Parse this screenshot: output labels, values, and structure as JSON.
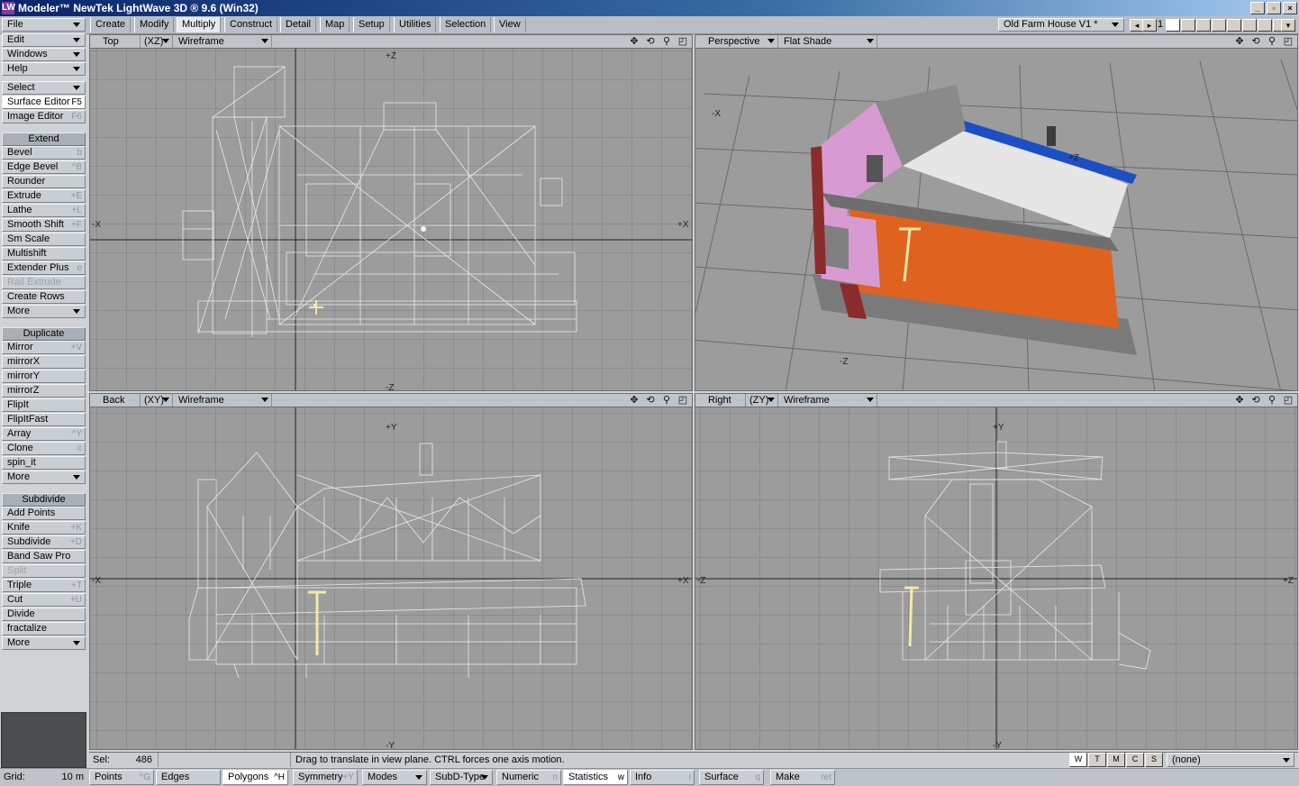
{
  "window": {
    "title": "Modeler™ NewTek LightWave 3D ® 9.6  (Win32)",
    "logo": "LW",
    "min": "_",
    "max": "▫",
    "close": "×"
  },
  "menu_tabs": [
    "Create",
    "Modify",
    "Multiply",
    "Construct",
    "Detail",
    "Map",
    "Setup",
    "Utilities",
    "Selection",
    "View"
  ],
  "active_tab": "Multiply",
  "object": {
    "name": "Old Farm House V1 *",
    "layer": "1"
  },
  "left_menus": [
    "File",
    "Edit",
    "Windows",
    "Help"
  ],
  "select_label": "Select",
  "surface_editor": {
    "label": "Surface Editor",
    "shortcut": "F5"
  },
  "image_editor": {
    "label": "Image Editor",
    "shortcut": "F6"
  },
  "extend": {
    "title": "Extend",
    "items": [
      {
        "label": "Bevel",
        "sc": "b"
      },
      {
        "label": "Edge Bevel",
        "sc": "^B"
      },
      {
        "label": "Rounder",
        "sc": ""
      },
      {
        "label": "Extrude",
        "sc": "+E"
      },
      {
        "label": "Lathe",
        "sc": "+L"
      },
      {
        "label": "Smooth Shift",
        "sc": "+F"
      },
      {
        "label": "Sm Scale",
        "sc": ""
      },
      {
        "label": "Multishift",
        "sc": ""
      },
      {
        "label": "Extender Plus",
        "sc": "e"
      },
      {
        "label": "Rail Extrude",
        "sc": ""
      },
      {
        "label": "Create Rows",
        "sc": ""
      },
      {
        "label": "More",
        "sc": ""
      }
    ]
  },
  "duplicate": {
    "title": "Duplicate",
    "items": [
      {
        "label": "Mirror",
        "sc": "+V"
      },
      {
        "label": "mirrorX",
        "sc": ""
      },
      {
        "label": "mirrorY",
        "sc": ""
      },
      {
        "label": "mirrorZ",
        "sc": ""
      },
      {
        "label": "FlipIt",
        "sc": ""
      },
      {
        "label": "FlipItFast",
        "sc": ""
      },
      {
        "label": "Array",
        "sc": "^Y"
      },
      {
        "label": "Clone",
        "sc": "c"
      },
      {
        "label": "spin_it",
        "sc": ""
      },
      {
        "label": "More",
        "sc": ""
      }
    ]
  },
  "subdivide": {
    "title": "Subdivide",
    "items": [
      {
        "label": "Add Points",
        "sc": ""
      },
      {
        "label": "Knife",
        "sc": "+K"
      },
      {
        "label": "Subdivide",
        "sc": "+D"
      },
      {
        "label": "Band Saw Pro",
        "sc": ""
      },
      {
        "label": "Split",
        "sc": ""
      },
      {
        "label": "Triple",
        "sc": "+T"
      },
      {
        "label": "Cut",
        "sc": "+U"
      },
      {
        "label": "Divide",
        "sc": ""
      },
      {
        "label": "fractalize",
        "sc": ""
      },
      {
        "label": "More",
        "sc": ""
      }
    ]
  },
  "viewports": {
    "top": {
      "view": "Top",
      "axes": "(XZ)",
      "mode": "Wireframe",
      "label_top": "+Z",
      "label_bottom": "-Z",
      "label_left": "-X",
      "label_right": "+X"
    },
    "persp": {
      "view": "Perspective",
      "mode": "Flat Shade",
      "label_x": "-X",
      "label_z": "+Z",
      "label_nz": "-Z"
    },
    "back": {
      "view": "Back",
      "axes": "(XY)",
      "mode": "Wireframe",
      "label_top": "+Y",
      "label_bottom": "-Y",
      "label_left": "-X",
      "label_right": "+X"
    },
    "right": {
      "view": "Right",
      "axes": "(ZY)",
      "mode": "Wireframe",
      "label_top": "+Y",
      "label_bottom": "-Y",
      "label_left": "-Z",
      "label_right": "+Z"
    }
  },
  "vp_icons": {
    "move": "✥",
    "rotate": "⟲",
    "zoom": "⚲",
    "max": "◰"
  },
  "status": {
    "sel_label": "Sel:",
    "sel_value": "486",
    "message": "Drag to translate in view plane. CTRL forces one axis motion.",
    "wtmcs": [
      "W",
      "T",
      "M",
      "C",
      "S"
    ],
    "surface": "(none)"
  },
  "grid": {
    "label": "Grid:",
    "value": "10 m"
  },
  "bottom": [
    {
      "label": "Points",
      "sc": "^G"
    },
    {
      "label": "Edges",
      "sc": ""
    },
    {
      "label": "Polygons",
      "sc": "^H"
    },
    {
      "label": "Symmetry",
      "sc": "+Y"
    },
    {
      "label": "Modes",
      "sc": ""
    },
    {
      "label": "SubD-Type",
      "sc": ""
    },
    {
      "label": "Numeric",
      "sc": "n"
    },
    {
      "label": "Statistics",
      "sc": "w"
    },
    {
      "label": "Info",
      "sc": "i"
    },
    {
      "label": "Surface",
      "sc": "q"
    },
    {
      "label": "Make",
      "sc": "ret"
    }
  ],
  "colors": {
    "accent": "#0a246a",
    "wall_orange": "#e0621f",
    "wall_pink": "#d79bd2",
    "roof_white": "#e6e6e6",
    "roof_blue": "#1d4fc4",
    "highlight_yellow": "#f3e9a4"
  }
}
